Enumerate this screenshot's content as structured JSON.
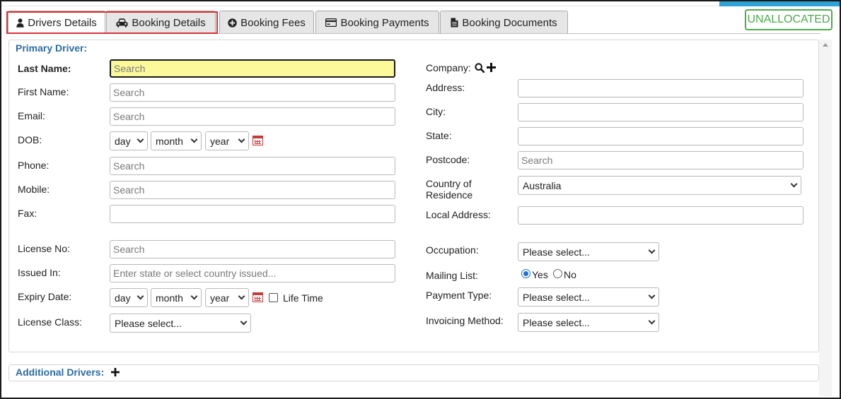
{
  "tabs": [
    {
      "label": "Drivers Details",
      "icon": "user-icon",
      "active": true
    },
    {
      "label": "Booking Details",
      "icon": "car-icon",
      "active": false
    },
    {
      "label": "Booking Fees",
      "icon": "plus-circle-icon",
      "active": false
    },
    {
      "label": "Booking Payments",
      "icon": "credit-card-icon",
      "active": false
    },
    {
      "label": "Booking Documents",
      "icon": "document-icon",
      "active": false
    }
  ],
  "status_badge": "UNALLOCATED",
  "colors": {
    "accent_blue": "#2c6da4",
    "badge_green": "#4caa4c",
    "focus_yellow": "#fbf99a",
    "highlight_red": "#d9333a"
  },
  "primary_driver": {
    "title": "Primary Driver:",
    "last_name": {
      "label": "Last Name:",
      "placeholder": "Search"
    },
    "first_name": {
      "label": "First Name:",
      "placeholder": "Search"
    },
    "email": {
      "label": "Email:",
      "placeholder": "Search"
    },
    "dob": {
      "label": "DOB:",
      "day": "day",
      "month": "month",
      "year": "year"
    },
    "phone": {
      "label": "Phone:",
      "placeholder": "Search"
    },
    "mobile": {
      "label": "Mobile:",
      "placeholder": "Search"
    },
    "fax": {
      "label": "Fax:",
      "placeholder": ""
    },
    "license_no": {
      "label": "License No:",
      "placeholder": "Search"
    },
    "issued_in": {
      "label": "Issued In:",
      "placeholder": "Enter state or select country issued..."
    },
    "expiry_date": {
      "label": "Expiry Date:",
      "day": "day",
      "month": "month",
      "year": "year",
      "life_time_label": "Life Time"
    },
    "license_class": {
      "label": "License Class:",
      "value": "Please select..."
    }
  },
  "company": {
    "label": "Company:",
    "address": {
      "label": "Address:"
    },
    "city": {
      "label": "City:"
    },
    "state": {
      "label": "State:"
    },
    "postcode": {
      "label": "Postcode:",
      "placeholder": "Search"
    },
    "country": {
      "label_line1": "Country of",
      "label_line2": "Residence",
      "value": "Australia"
    },
    "local_address": {
      "label": "Local Address:"
    },
    "occupation": {
      "label": "Occupation:",
      "value": "Please select..."
    },
    "mailing_list": {
      "label": "Mailing List:",
      "yes": "Yes",
      "no": "No",
      "selected": "Yes"
    },
    "payment_type": {
      "label": "Payment Type:",
      "value": "Please select..."
    },
    "invoicing_method": {
      "label": "Invoicing Method:",
      "value": "Please select..."
    }
  },
  "additional_drivers": {
    "title": "Additional Drivers:"
  }
}
